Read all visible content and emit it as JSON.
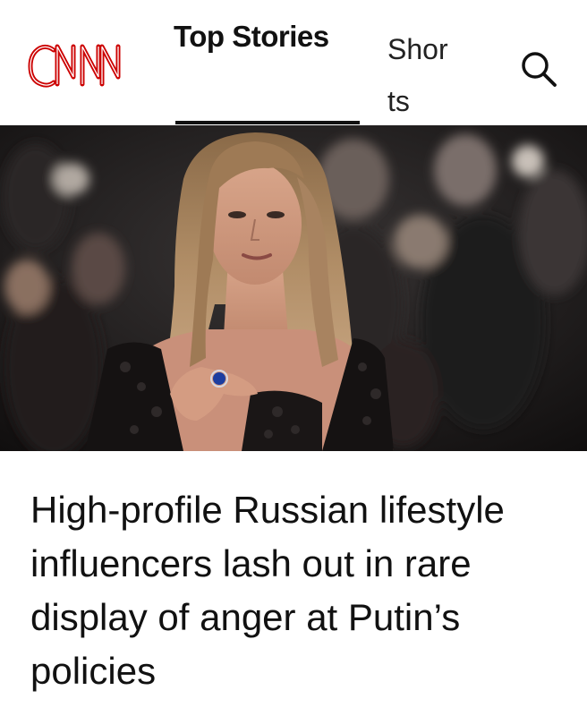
{
  "header": {
    "logo_text": "CNN",
    "tabs": [
      {
        "label": "Top Stories",
        "active": true
      },
      {
        "label": "Shorts",
        "active": false
      }
    ],
    "search_icon": "search-icon",
    "brand_color": "#cc0000"
  },
  "article": {
    "headline": "High-profile Russian lifestyle influencers lash out in rare display of anger at Putin’s policies"
  }
}
